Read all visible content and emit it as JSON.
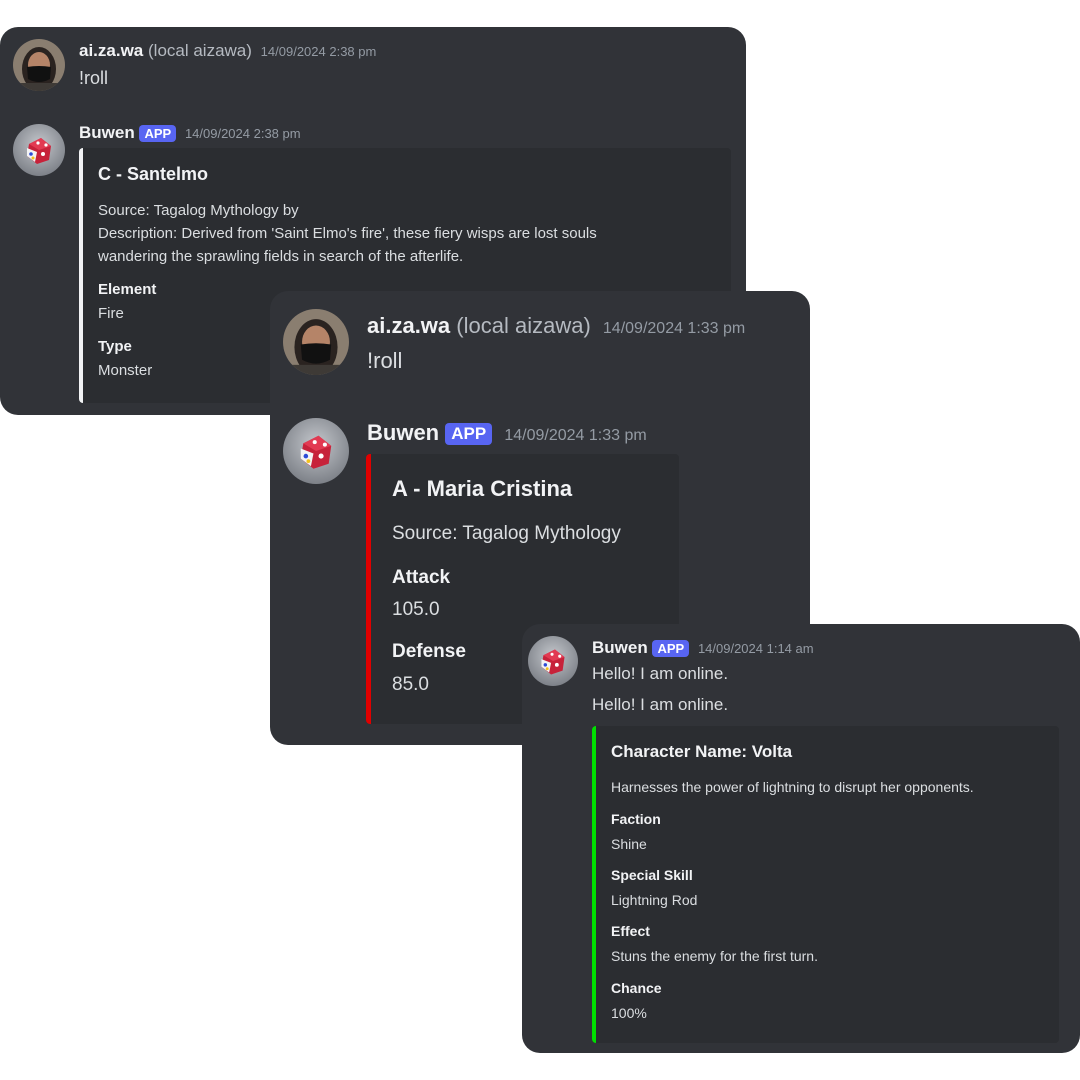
{
  "screen1": {
    "user_message": {
      "username": "ai.za.wa",
      "local_name": "(local aizawa)",
      "timestamp": "14/09/2024 2:38 pm",
      "text": "!roll"
    },
    "bot_message": {
      "username": "Buwen",
      "badge": "APP",
      "timestamp": "14/09/2024 2:38 pm",
      "embed": {
        "accent_color": "#f2f3f5",
        "title": "C - Santelmo",
        "source": "Source: Tagalog Mythology by",
        "description_line1": "Description: Derived from 'Saint Elmo's fire', these fiery wisps are lost souls",
        "description_line2": "wandering the sprawling fields in search of the afterlife.",
        "fields": [
          {
            "name": "Element",
            "value": "Fire"
          },
          {
            "name": "Type",
            "value": "Monster"
          }
        ]
      }
    }
  },
  "screen2": {
    "user_message": {
      "username": "ai.za.wa",
      "local_name": "(local aizawa)",
      "timestamp": "14/09/2024 1:33 pm",
      "text": "!roll"
    },
    "bot_message": {
      "username": "Buwen",
      "badge": "APP",
      "timestamp": "14/09/2024 1:33 pm",
      "embed": {
        "accent_color": "#e00000",
        "title": "A - Maria Cristina",
        "source": "Source: Tagalog Mythology",
        "fields": [
          {
            "name": "Attack",
            "value": "105.0"
          },
          {
            "name": "Defense",
            "value": "85.0"
          }
        ]
      }
    }
  },
  "screen3": {
    "bot_message": {
      "username": "Buwen",
      "badge": "APP",
      "timestamp": "14/09/2024 1:14 am",
      "lines": [
        "Hello! I am online.",
        "Hello! I am online."
      ],
      "embed": {
        "accent_color": "#00e000",
        "title": "Character Name: Volta",
        "description": "Harnesses the power of lightning to disrupt her opponents.",
        "fields": [
          {
            "name": "Faction",
            "value": "Shine"
          },
          {
            "name": "Special Skill",
            "value": "Lightning Rod"
          },
          {
            "name": "Effect",
            "value": "Stuns the enemy for the first turn."
          },
          {
            "name": "Chance",
            "value": "100%"
          }
        ]
      }
    }
  },
  "icons": {
    "user_avatar": "masked-person-avatar-icon",
    "bot_avatar": "dice-avatar-icon"
  }
}
